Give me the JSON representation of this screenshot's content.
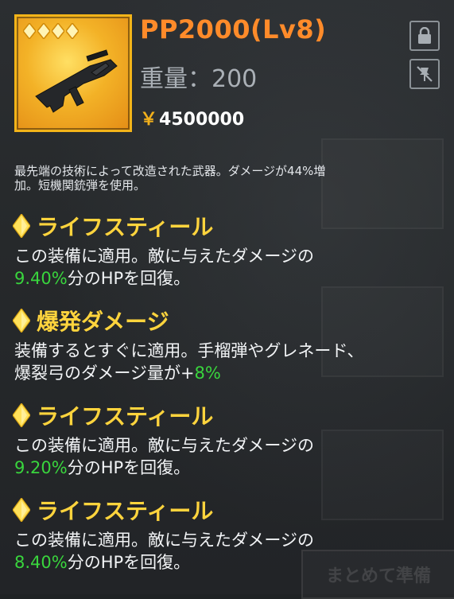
{
  "item": {
    "name": "PP2000(Lv8)",
    "weight_label": "重量：",
    "weight_value": "200",
    "price_symbol": "￥",
    "price_value": "4500000",
    "stars": 4,
    "description": "最先端の技術によって改造された武器。ダメージが44%増\n加。短機関銃弾を使用。"
  },
  "skills": [
    {
      "name": "ライフスティール",
      "text_before": "この装備に適用。敵に与えたダメージの",
      "text_line2_value": "9.40%",
      "text_after": "分のHPを回復。"
    },
    {
      "name": "爆発ダメージ",
      "text_before": "装備するとすぐに適用。手榴弾やグレネード、",
      "text_line2_prefix": "爆裂弓のダメージ量が+",
      "text_line2_value": "8%"
    },
    {
      "name": "ライフスティール",
      "text_before": "この装備に適用。敵に与えたダメージの",
      "text_line2_value": "9.20%",
      "text_after": "分のHPを回復。"
    },
    {
      "name": "ライフスティール",
      "text_before": "この装備に適用。敵に与えたダメージの",
      "text_line2_value": "8.40%",
      "text_after": "分のHPを回復。"
    }
  ],
  "buttons": {
    "lock_icon": "lock-icon",
    "unpin_icon": "unpin-icon",
    "ghost_label": "まとめて準備"
  },
  "colors": {
    "title": "#ff8b2a",
    "skill_name": "#ffd43d",
    "highlight": "#39d53d",
    "frame": "#f3b419"
  }
}
